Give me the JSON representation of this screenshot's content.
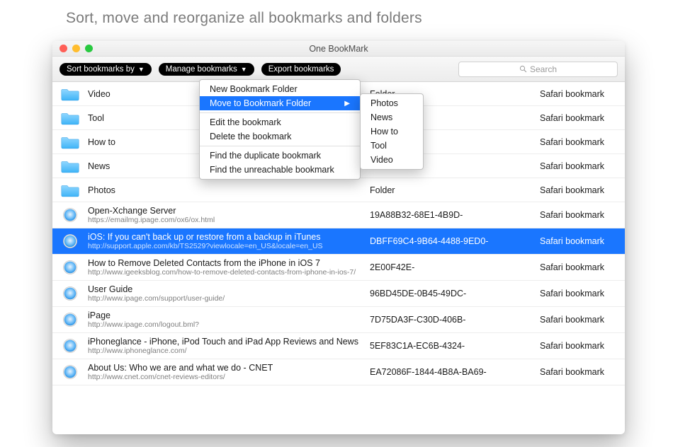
{
  "page_heading": "Sort, move and reorganize all bookmarks and folders",
  "window_title": "One BookMark",
  "toolbar": {
    "sort_label": "Sort bookmarks by",
    "manage_label": "Manage bookmarks",
    "export_label": "Export bookmarks"
  },
  "search": {
    "placeholder": "Search"
  },
  "columns": {
    "folder_kind": "Folder",
    "source": "Safari bookmark"
  },
  "folders": [
    {
      "name": "Video"
    },
    {
      "name": "Tool"
    },
    {
      "name": "How to"
    },
    {
      "name": "News"
    },
    {
      "name": "Photos"
    }
  ],
  "bookmarks": [
    {
      "title": "Open-Xchange Server",
      "url": "https://emailmg.ipage.com/ox6/ox.html",
      "id": "19A88B32-68E1-4B9D-",
      "selected": false
    },
    {
      "title": "iOS: If you can't back up or restore from a backup in iTunes",
      "url": "http://support.apple.com/kb/TS2529?viewlocale=en_US&locale=en_US",
      "id": "DBFF69C4-9B64-4488-9ED0-",
      "selected": true
    },
    {
      "title": "How to Remove Deleted Contacts from the iPhone in iOS 7",
      "url": "http://www.igeeksblog.com/how-to-remove-deleted-contacts-from-iphone-in-ios-7/",
      "id": "2E00F42E-",
      "selected": false
    },
    {
      "title": "User Guide",
      "url": "http://www.ipage.com/support/user-guide/",
      "id": "96BD45DE-0B45-49DC-",
      "selected": false
    },
    {
      "title": "iPage",
      "url": "http://www.ipage.com/logout.bml?",
      "id": "7D75DA3F-C30D-406B-",
      "selected": false
    },
    {
      "title": "iPhoneglance - iPhone, iPod Touch and iPad App Reviews and News",
      "url": "http://www.iphoneglance.com/",
      "id": "5EF83C1A-EC6B-4324-",
      "selected": false
    },
    {
      "title": "About Us: Who we are and what we do - CNET",
      "url": "http://www.cnet.com/cnet-reviews-editors/",
      "id": "EA72086F-1844-4B8A-BA69-",
      "selected": false
    }
  ],
  "manage_menu": {
    "items": [
      {
        "label": "New Bookmark Folder",
        "highlight": false
      },
      {
        "label": "Move to Bookmark Folder",
        "highlight": true,
        "submenu": true
      },
      {
        "sep": true
      },
      {
        "label": "Edit the bookmark"
      },
      {
        "label": "Delete the bookmark"
      },
      {
        "sep": true
      },
      {
        "label": "Find the duplicate bookmark"
      },
      {
        "label": "Find the unreachable bookmark"
      }
    ]
  },
  "submenu": {
    "items": [
      {
        "label": "Photos"
      },
      {
        "label": "News"
      },
      {
        "label": "How to"
      },
      {
        "label": "Tool"
      },
      {
        "label": "Video"
      }
    ]
  }
}
